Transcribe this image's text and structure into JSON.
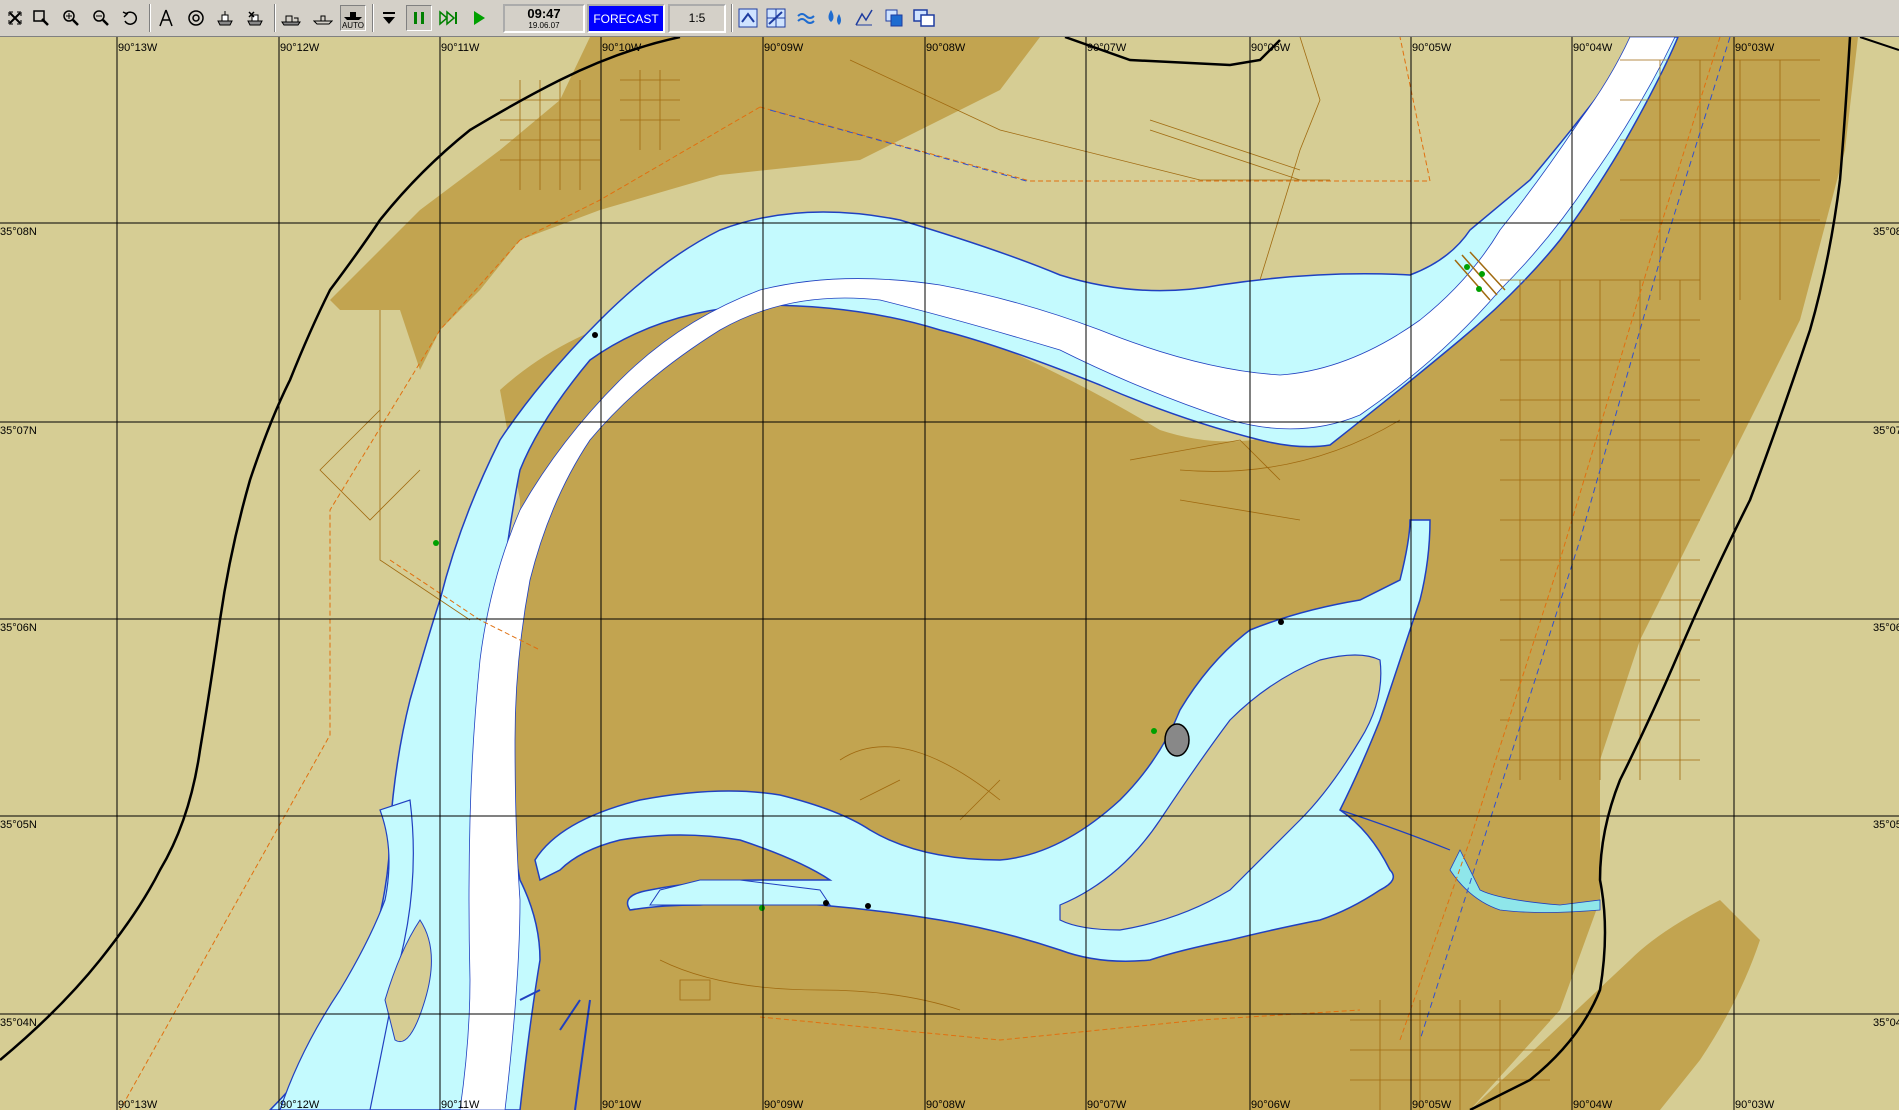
{
  "toolbar": {
    "time": "09:47",
    "date": "19.06.07",
    "forecast_label": "FORECAST",
    "scale": "1:5",
    "auto_label": "AUTO",
    "icons": [
      "fit-icon",
      "zoom-window-icon",
      "zoom-in-icon",
      "zoom-out-icon",
      "undo-icon",
      "compass-icon",
      "target-icon",
      "ship-icon",
      "ship-delete-icon",
      "route-icon",
      "ship-profile-icon",
      "auto-mode-icon",
      "drop-down-icon",
      "pause-icon",
      "fast-forward-icon",
      "play-icon",
      "chart-rotate-icon",
      "chart-grid-icon",
      "weather-icon",
      "depth-icon",
      "tide-icon",
      "layers-icon",
      "windows-icon"
    ]
  },
  "map": {
    "lon_labels": [
      "90°13W",
      "90°12W",
      "90°11W",
      "90°10W",
      "90°09W",
      "90°08W",
      "90°07W",
      "90°06W",
      "90°05W",
      "90°04W",
      "90°03W"
    ],
    "lat_labels": [
      "35°08N",
      "35°07N",
      "35°06N",
      "35°05N",
      "35°04N"
    ],
    "lat_labels_right": [
      "35°08",
      "35°07",
      "35°06",
      "35°05",
      "35°04"
    ],
    "colors": {
      "land_light": "#d6cd94",
      "land_urban": "#c2a450",
      "water_shallow": "#c4fafe",
      "water_deep": "#ffffff",
      "coastline": "#2040c0",
      "grid": "#000000",
      "road": "#a06a10",
      "boundary": "#e07010"
    }
  }
}
